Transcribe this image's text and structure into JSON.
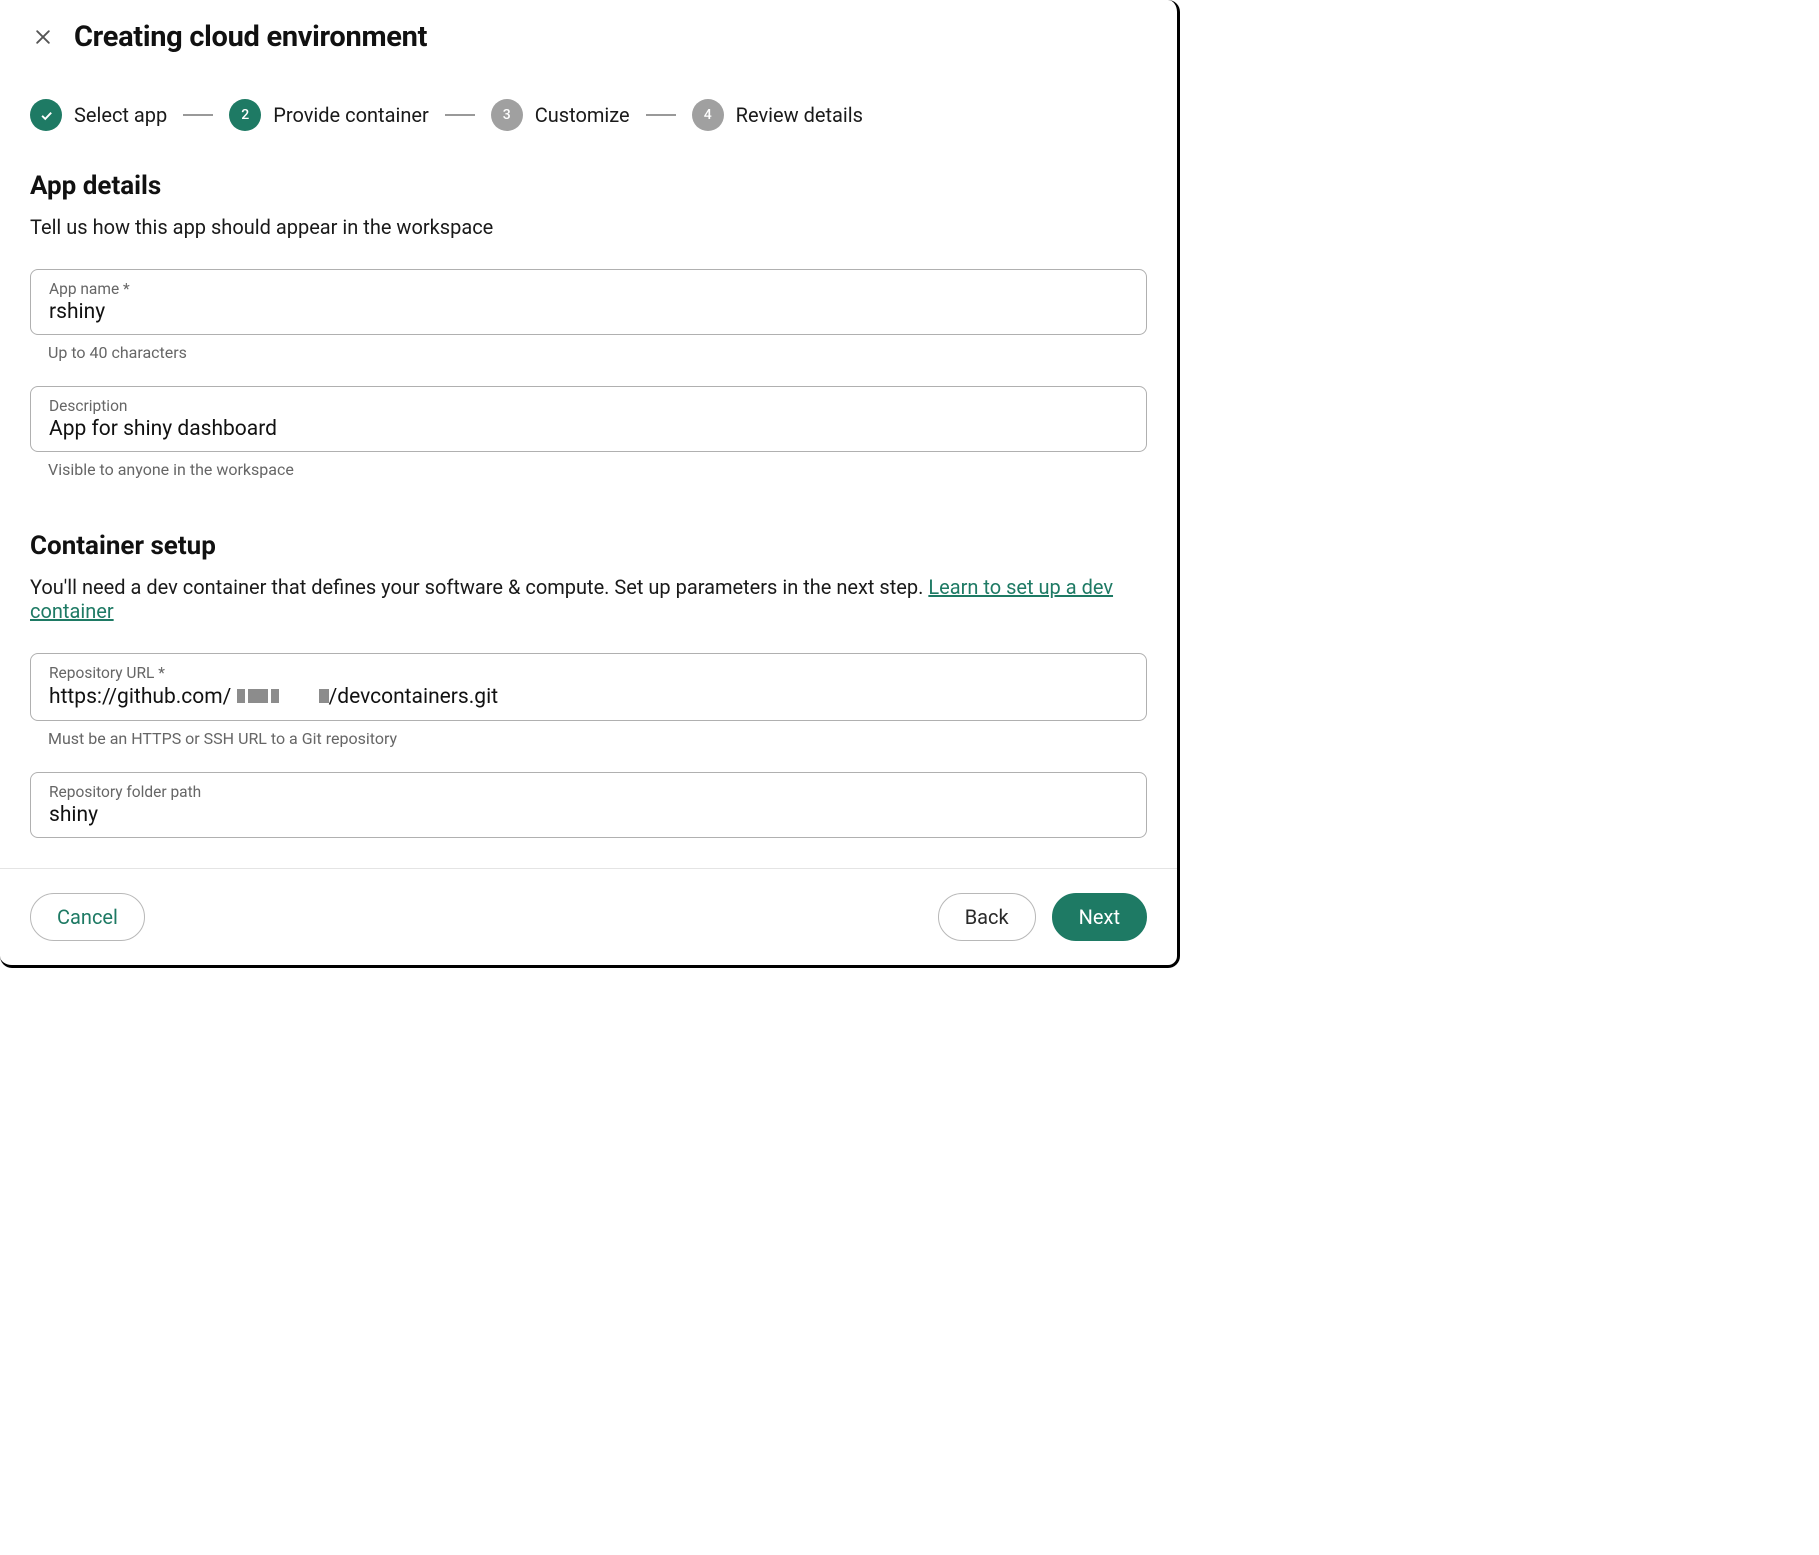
{
  "dialog": {
    "title": "Creating cloud environment"
  },
  "stepper": {
    "steps": [
      {
        "label": "Select app",
        "state": "done"
      },
      {
        "label": "Provide container",
        "state": "active",
        "num": "2"
      },
      {
        "label": "Customize",
        "state": "pending",
        "num": "3"
      },
      {
        "label": "Review details",
        "state": "pending",
        "num": "4"
      }
    ]
  },
  "app_details": {
    "heading": "App details",
    "subheading": "Tell us how this app should appear in the workspace",
    "name_label": "App name *",
    "name_value": "rshiny",
    "name_help": "Up to 40 characters",
    "desc_label": "Description",
    "desc_value": "App for shiny dashboard",
    "desc_help": "Visible to anyone in the workspace"
  },
  "container": {
    "heading": "Container setup",
    "subheading_pre": "You'll need a dev container that defines your software & compute. Set up parameters in the next step. ",
    "subheading_link": "Learn to set up a dev container",
    "repo_label": "Repository URL *",
    "repo_prefix": "https://github.com/ ",
    "repo_suffix": "/devcontainers.git",
    "repo_help": "Must be an HTTPS or SSH URL to a Git repository",
    "folder_label": "Repository folder path",
    "folder_value": "shiny"
  },
  "footer": {
    "cancel": "Cancel",
    "back": "Back",
    "next": "Next"
  }
}
